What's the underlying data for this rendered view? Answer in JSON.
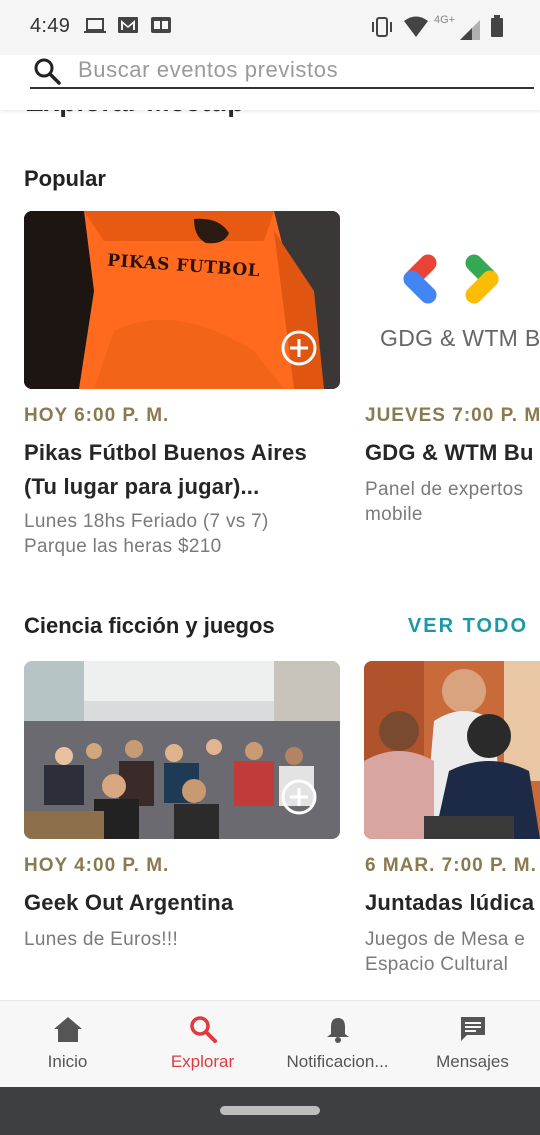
{
  "status_bar": {
    "time": "4:49",
    "left_icons": [
      "laptop-icon",
      "gmail-icon",
      "ge-icon"
    ],
    "right_icons": [
      "vibrate-icon",
      "wifi-icon",
      "signal-icon",
      "battery-icon"
    ],
    "network_label": "4G+"
  },
  "search": {
    "placeholder": "Buscar eventos previstos",
    "value": ""
  },
  "page": {
    "heading": "Explorar Meetup"
  },
  "sections": [
    {
      "title": "Popular",
      "see_all": "",
      "cards": [
        {
          "date": "HOY 6:00 P. M.",
          "title_lines": [
            "Pikas Fútbol Buenos Aires",
            "(Tu lugar para jugar)..."
          ],
          "desc_lines": [
            "Lunes 18hs Feriado (7 vs 7)",
            "Parque las heras $210"
          ],
          "image_text": "PIKAS FUTBOL"
        },
        {
          "date": "JUEVES 7:00 P. M.",
          "title_lines": [
            "GDG & WTM Bu"
          ],
          "desc_lines": [
            "Panel de expertos",
            "mobile"
          ],
          "image_text": "GDG & WTM B"
        }
      ]
    },
    {
      "title": "Ciencia ficción y juegos",
      "see_all": "VER TODO",
      "cards": [
        {
          "date": "HOY 4:00 P. M.",
          "title_lines": [
            "Geek Out Argentina"
          ],
          "desc_lines": [
            "Lunes de Euros!!!"
          ]
        },
        {
          "date": "6 MAR. 7:00 P. M.",
          "title_lines": [
            "Juntadas lúdica"
          ],
          "desc_lines": [
            "Juegos de Mesa e",
            "Espacio Cultural"
          ]
        }
      ]
    }
  ],
  "bottom_nav": [
    {
      "label": "Inicio",
      "icon": "home-icon",
      "active": false
    },
    {
      "label": "Explorar",
      "icon": "search-icon",
      "active": true
    },
    {
      "label": "Notificacion...",
      "icon": "bell-icon",
      "active": false
    },
    {
      "label": "Mensajes",
      "icon": "message-icon",
      "active": false
    }
  ],
  "colors": {
    "accent_active": "#e0393e",
    "date_text": "#8a7a4f",
    "link": "#1a9aa6"
  }
}
